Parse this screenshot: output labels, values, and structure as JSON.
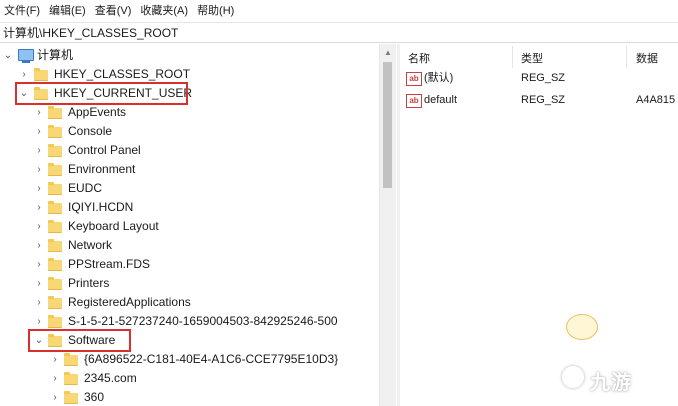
{
  "menu": [
    "文件(F)",
    "编辑(E)",
    "查看(V)",
    "收藏夹(A)",
    "帮助(H)"
  ],
  "address": "计算机\\HKEY_CLASSES_ROOT",
  "tree": {
    "root_label": "计算机",
    "hkcr_label": "HKEY_CLASSES_ROOT",
    "hkcu_label": "HKEY_CURRENT_USER",
    "hkcu_children": [
      "AppEvents",
      "Console",
      "Control Panel",
      "Environment",
      "EUDC",
      "IQIYI.HCDN",
      "Keyboard Layout",
      "Network",
      "PPStream.FDS",
      "Printers",
      "RegisteredApplications",
      "S-1-5-21-527237240-1659004503-842925246-500"
    ],
    "software_label": "Software",
    "software_children": [
      "{6A896522-C181-40E4-A1C6-CCE7795E10D3}",
      "2345.com",
      "360"
    ]
  },
  "list": {
    "columns": [
      "名称",
      "类型",
      "数据"
    ],
    "rows": [
      {
        "icon": "string-value-icon",
        "name": "(默认)",
        "type": "REG_SZ",
        "data": ""
      },
      {
        "icon": "string-value-icon",
        "name": "default",
        "type": "REG_SZ",
        "data": "A4A815"
      }
    ]
  },
  "watermark": "九游",
  "colors": {
    "highlight": "#d9302e",
    "folder": "#f8d775"
  }
}
